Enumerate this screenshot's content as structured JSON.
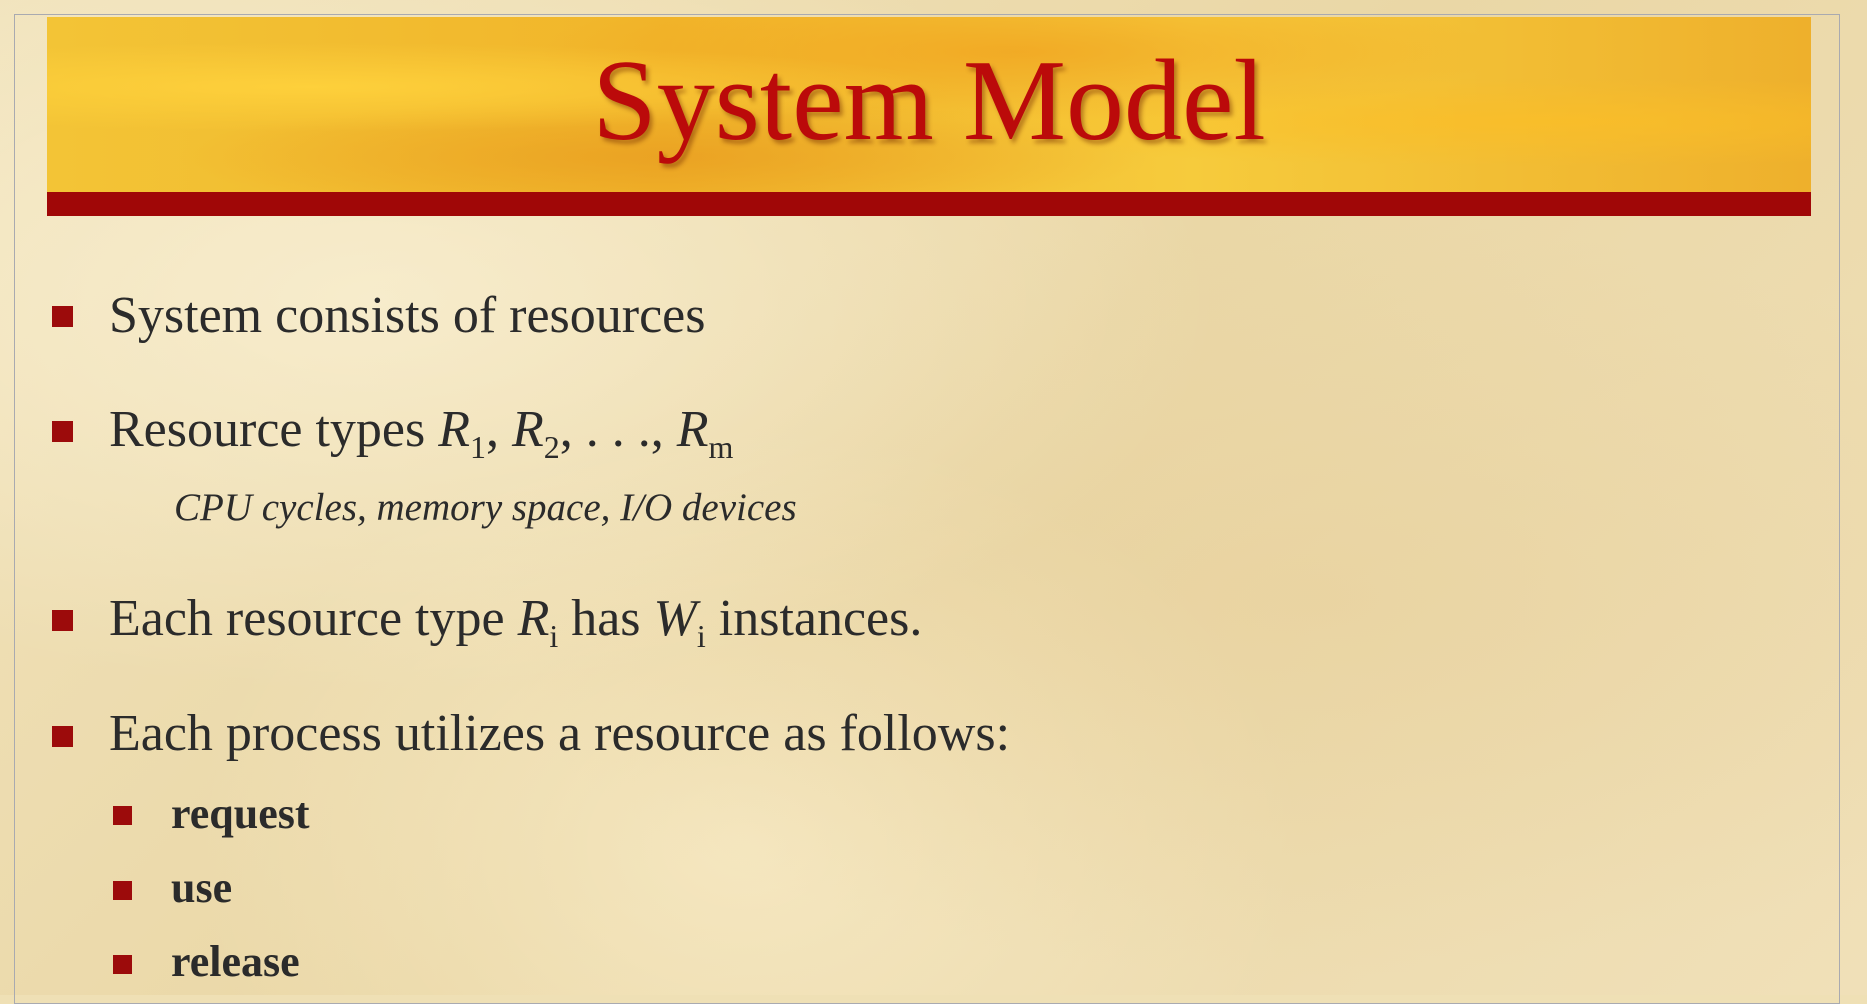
{
  "slide": {
    "title": "System Model",
    "bullets": [
      {
        "text": "System consists of resources"
      },
      {
        "prefix": "Resource types ",
        "sym": "R",
        "sub1": "1",
        "sep1": ", ",
        "sub2": "2",
        "sep2": ", . . ., ",
        "subm": "m",
        "detail": "CPU cycles, memory space, I/O devices"
      },
      {
        "prefix": "Each resource type ",
        "sym_r": "R",
        "sub_r": "i",
        "mid": " has ",
        "sym_w": "W",
        "sub_w": "i",
        "suffix": " instances."
      },
      {
        "text": "Each process utilizes a resource as follows:",
        "steps": [
          "request",
          "use",
          "release"
        ]
      }
    ]
  },
  "colors": {
    "title": "#bb0a0a",
    "bullet": "#9c0b0b",
    "banner_bar": "#a00707",
    "text": "#2b2b2b"
  }
}
